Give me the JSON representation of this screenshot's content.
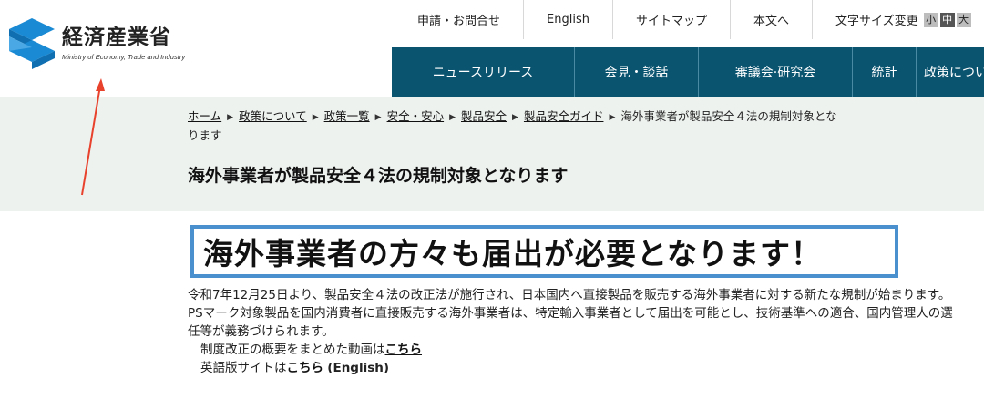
{
  "logo": {
    "title": "経済産業省",
    "subtitle": "Ministry of Economy, Trade and Industry",
    "brand_color": "#1a8ad4"
  },
  "util_nav": {
    "items": [
      "申請・お問合せ",
      "English",
      "サイトマップ",
      "本文へ"
    ],
    "font_size_label": "文字サイズ変更",
    "sizes": [
      "小",
      "中",
      "大"
    ]
  },
  "main_nav": {
    "items": [
      "ニュースリリース",
      "会見・談話",
      "審議会·研究会",
      "統計",
      "政策について"
    ],
    "color": "#0b5470"
  },
  "breadcrumb": {
    "links": [
      "ホーム",
      "政策について",
      "政策一覧",
      "安全・安心",
      "製品安全",
      "製品安全ガイド"
    ],
    "current": "海外事業者が製品安全４法の規制対象となります"
  },
  "page_title": "海外事業者が製品安全４法の規制対象となります",
  "banner": {
    "text": "海外事業者の方々も届出が必要となります！",
    "border_color": "#4a8fce"
  },
  "body": {
    "line1": "令和7年12月25日より、製品安全４法の改正法が施行され、日本国内へ直接製品を販売する海外事業者に対する新たな規制が始まります。",
    "line2": "PSマーク対象製品を国内消費者に直接販売する海外事業者は、特定輸入事業者として届出を可能とし、技術基準への適合、国内管理人の選",
    "line3": "任等が義務づけられます。",
    "video_prefix": "制度改正の概要をまとめた動画は",
    "video_link": "こちら",
    "english_prefix": "英語版サイトは",
    "english_link": "こちら",
    "english_suffix": "(English)"
  },
  "annotation_color": "#e8412c"
}
